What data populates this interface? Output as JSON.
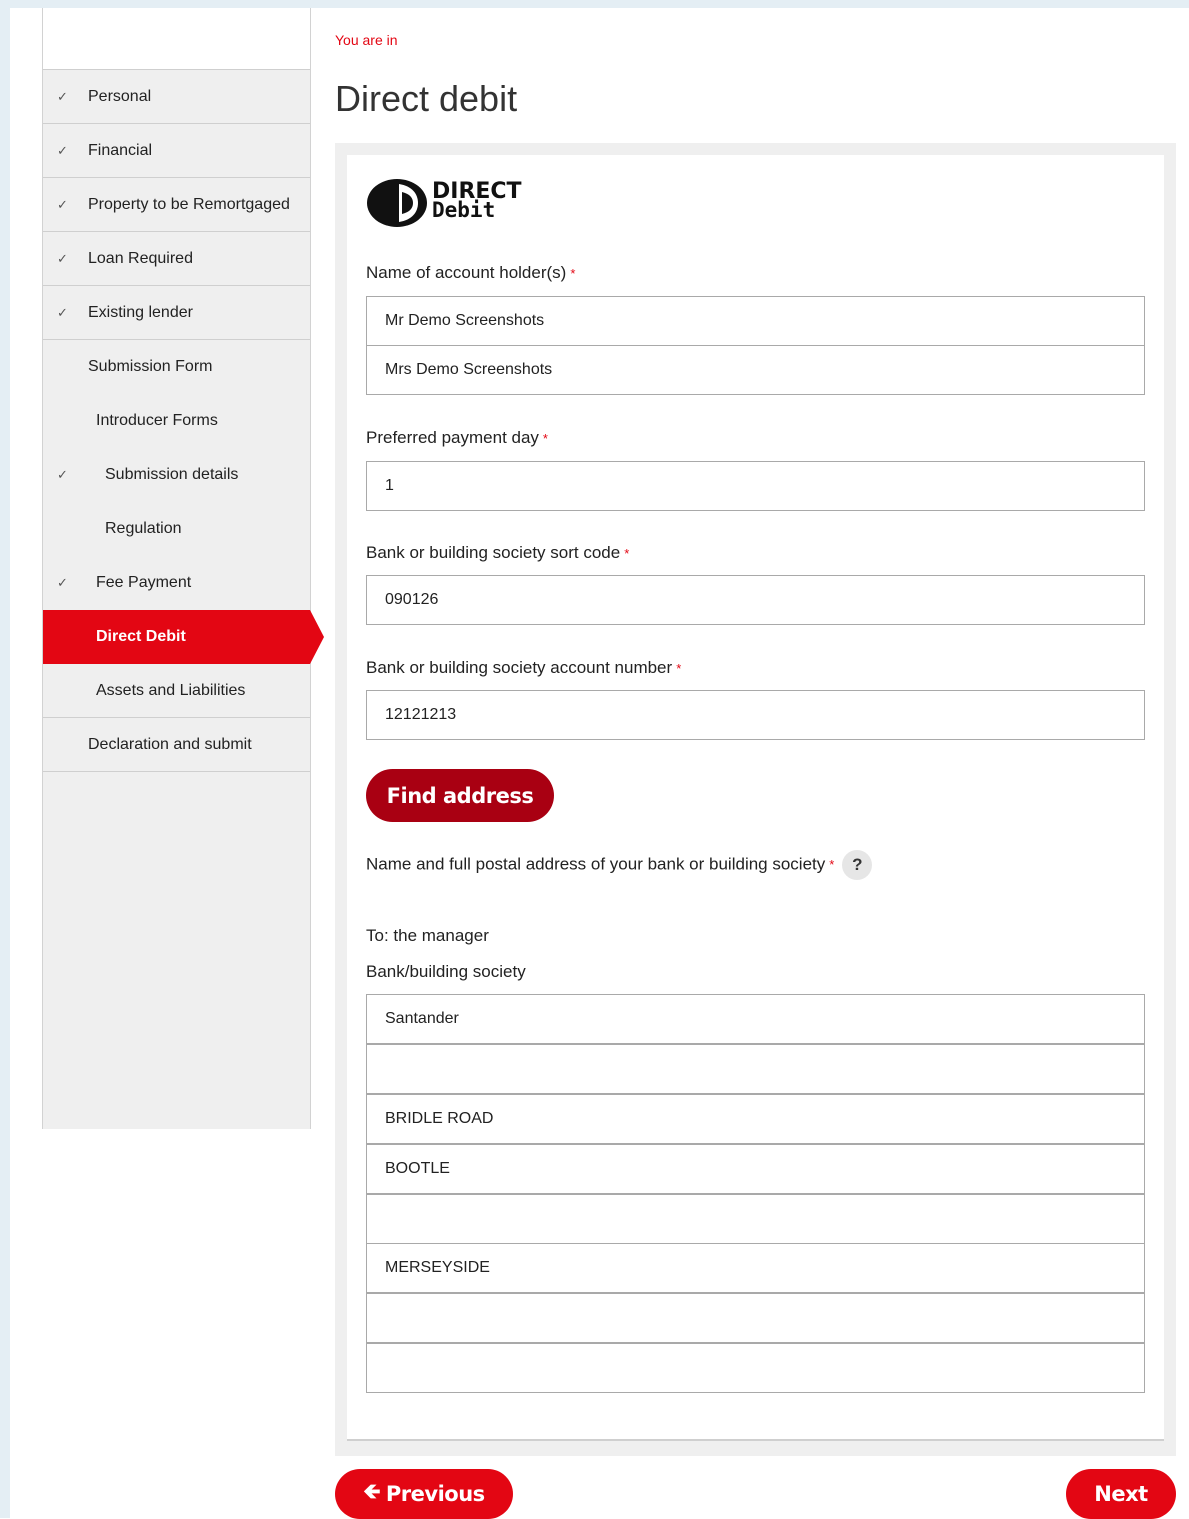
{
  "breadcrumb": "You are in",
  "page_title": "Direct debit",
  "logo": {
    "line1": "DIRECT",
    "line2": "Debit"
  },
  "sidebar": {
    "items": [
      {
        "label": "Personal",
        "checked": true
      },
      {
        "label": "Financial",
        "checked": true
      },
      {
        "label": "Property to be Remortgaged",
        "checked": true
      },
      {
        "label": "Loan Required",
        "checked": true
      },
      {
        "label": "Existing lender",
        "checked": true
      },
      {
        "label": "Submission Form",
        "checked": false
      },
      {
        "label": "Introducer Forms",
        "checked": false
      },
      {
        "label": "Submission details",
        "checked": true
      },
      {
        "label": "Regulation",
        "checked": false
      },
      {
        "label": "Fee Payment",
        "checked": true
      },
      {
        "label": "Direct Debit",
        "checked": false,
        "active": true
      },
      {
        "label": "Assets and Liabilities",
        "checked": false
      },
      {
        "label": "Declaration and submit",
        "checked": false
      }
    ],
    "check_glyph": "✓"
  },
  "form": {
    "account_holder_label": "Name of account holder(s)",
    "account_holder_1": "Mr Demo Screenshots",
    "account_holder_2": "Mrs Demo Screenshots",
    "payment_day_label": "Preferred payment day",
    "payment_day": "1",
    "sort_code_label": "Bank or building society sort code",
    "sort_code": "090126",
    "account_number_label": "Bank or building society account number",
    "account_number": "12121213",
    "find_address_button": "Find address",
    "bank_address_label": "Name and full postal address of your bank or building society",
    "help_glyph": "?",
    "to_manager": "To: the manager",
    "bank_label": "Bank/building society",
    "bank_lines": [
      "Santander",
      "",
      "BRIDLE ROAD",
      "BOOTLE",
      "",
      "MERSEYSIDE",
      "",
      ""
    ],
    "required_mark": "*"
  },
  "nav": {
    "previous_label": "Previous",
    "previous_arrow": "🡸",
    "next_label": "Next"
  },
  "colors": {
    "accent": "#e30613",
    "dark_accent": "#a90012"
  }
}
